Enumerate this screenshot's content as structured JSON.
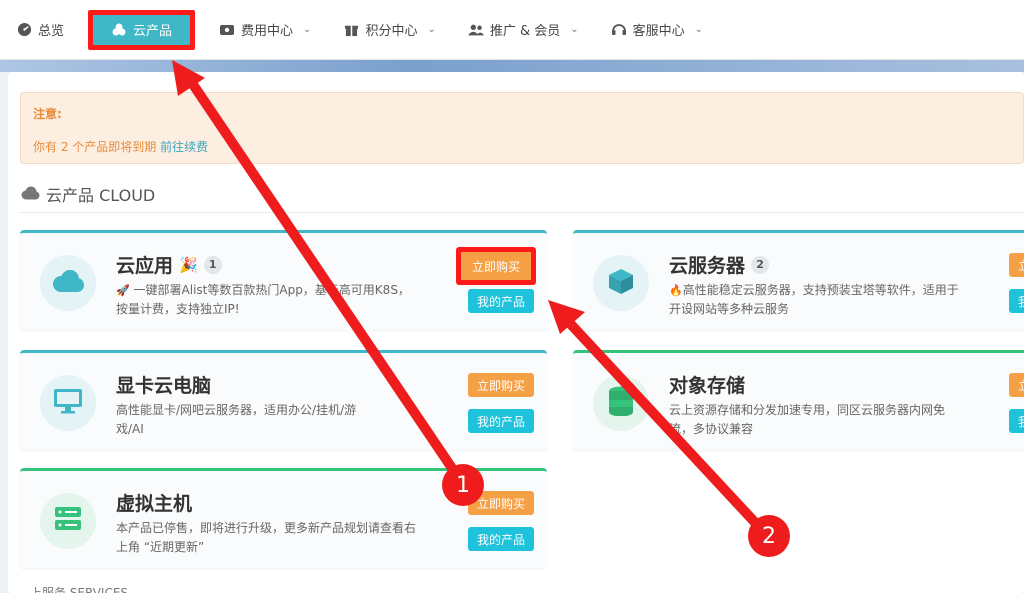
{
  "nav": {
    "items": [
      {
        "label": "总览",
        "icon": "dashboard-icon"
      },
      {
        "label": "云产品",
        "icon": "cloud-products-icon"
      },
      {
        "label": "费用中心",
        "icon": "wallet-icon"
      },
      {
        "label": "积分中心",
        "icon": "gift-icon"
      },
      {
        "label": "推广 & 会员",
        "icon": "users-icon"
      },
      {
        "label": "客服中心",
        "icon": "headset-icon"
      }
    ]
  },
  "notice": {
    "title": "注意:",
    "text": "你有 2 个产品即将到期",
    "link": "前往续费"
  },
  "section": {
    "title": "云产品 CLOUD"
  },
  "cards": [
    {
      "title": "云应用",
      "badge": "1",
      "desc_line1": "一键部署Alist等数百款热门App，基于高可用K8S，",
      "desc_line2": "按量计费，支持独立IP!",
      "buy": "立即购买",
      "mine": "我的产品"
    },
    {
      "title": "云服务器",
      "badge": "2",
      "desc_line1": "高性能稳定云服务器，支持预装宝塔等软件，适用于",
      "desc_line2": "开设网站等多种云服务",
      "buy": "立",
      "mine": "我"
    },
    {
      "title": "显卡云电脑",
      "desc_line1": "高性能显卡/网吧云服务器，适用办公/挂机/游",
      "desc_line2": "戏/AI",
      "buy": "立即购买",
      "mine": "我的产品"
    },
    {
      "title": "对象存储",
      "desc_line1": "云上资源存储和分发加速专用，同区云服务器内网免",
      "desc_line2": "流，多协议兼容",
      "buy": "立",
      "mine": "我"
    },
    {
      "title": "虚拟主机",
      "desc_line1": "本产品已停售，即将进行升级，更多新产品规划请查看右",
      "desc_line2": "上角 “近期更新”",
      "buy": "立即购买",
      "mine": "我的产品"
    }
  ],
  "markers": {
    "one": "1",
    "two": "2"
  },
  "bottom": {
    "text": "上服务 SERVICES"
  },
  "colors": {
    "accent": "#3fb7c7",
    "buy": "#f6a046",
    "mine": "#1ec2db",
    "highlight": "#ff1a1a"
  }
}
